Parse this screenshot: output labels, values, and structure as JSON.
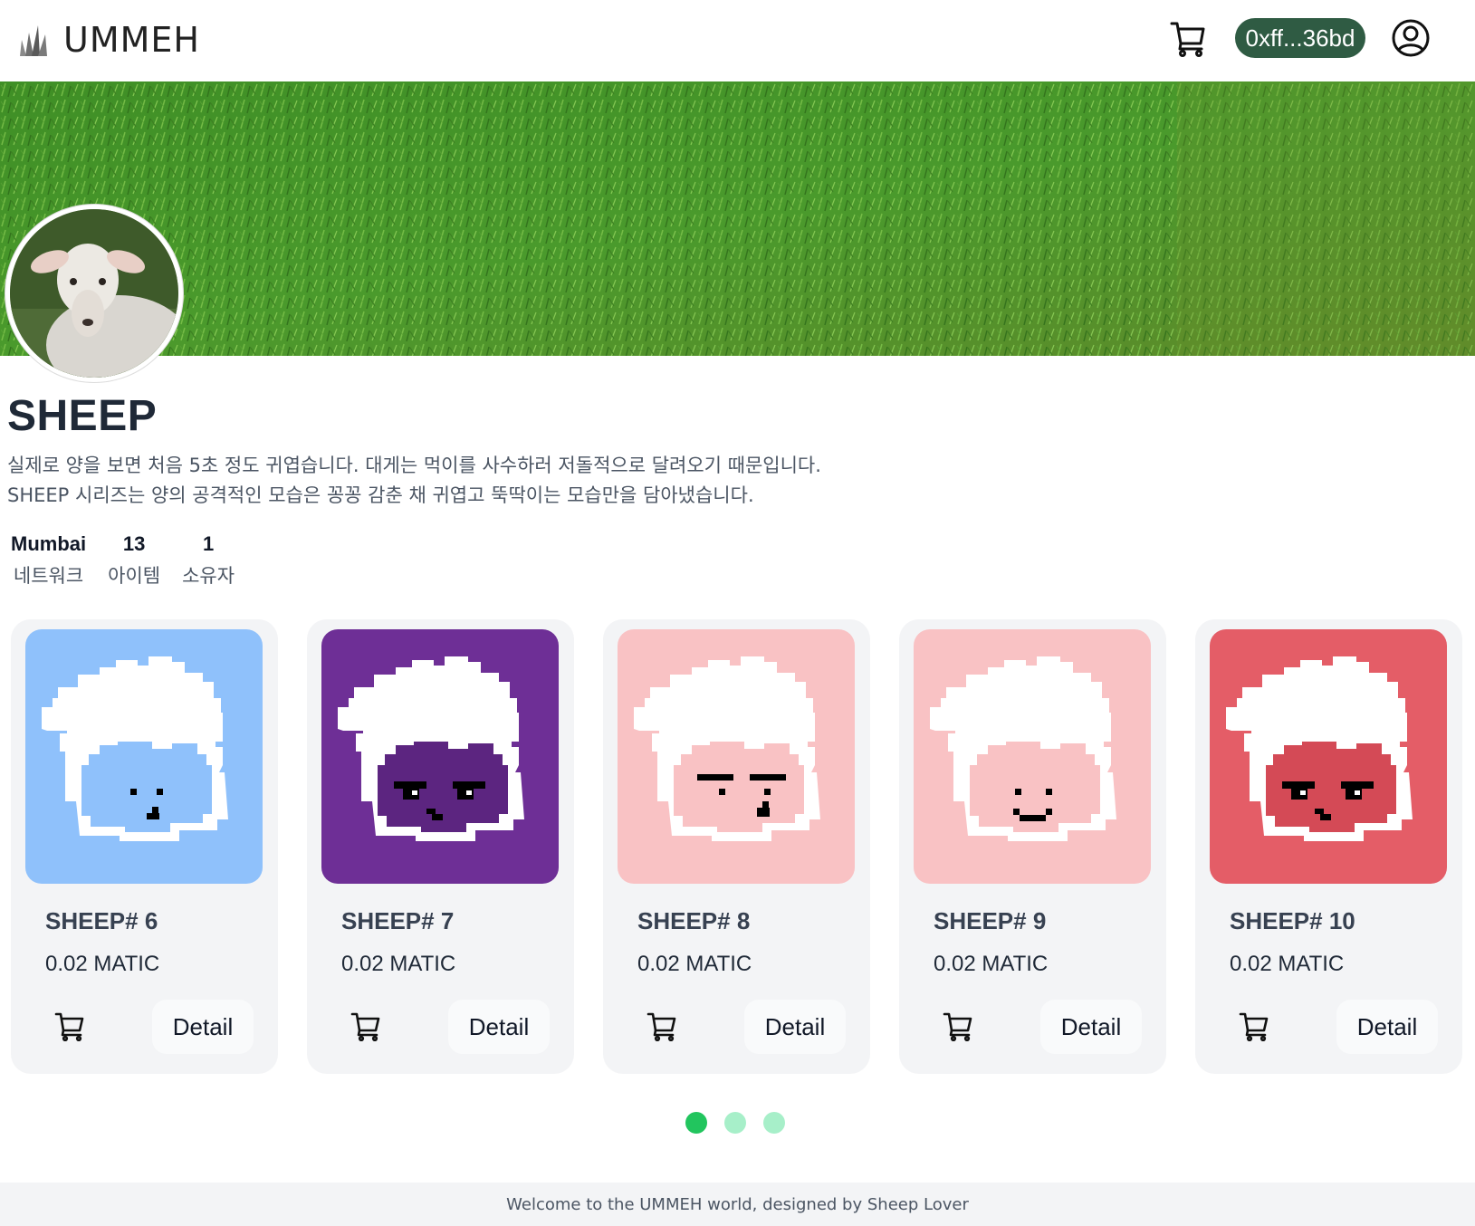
{
  "header": {
    "logo_text": "UMMEH",
    "wallet_label": "0xff...36bd"
  },
  "collection": {
    "title": "SHEEP",
    "description_line1": "실제로 양을 보면 처음 5초 정도 귀엽습니다. 대게는 먹이를 사수하러 저돌적으로 달려오기 때문입니다.",
    "description_line2": "SHEEP 시리즈는 양의 공격적인 모습은 꽁꽁 감춘 채 귀엽고 뚝딱이는 모습만을 담아냈습니다.",
    "stats": [
      {
        "value": "Mumbai",
        "label": "네트워크"
      },
      {
        "value": "13",
        "label": "아이템"
      },
      {
        "value": "1",
        "label": "소유자"
      }
    ]
  },
  "cards": [
    {
      "name": "SHEEP# 6",
      "price": "0.02 MATIC",
      "detail_label": "Detail",
      "bg": "#8fc1fb",
      "face": "neutral"
    },
    {
      "name": "SHEEP# 7",
      "price": "0.02 MATIC",
      "detail_label": "Detail",
      "bg": "#6e2f96",
      "face": "angry"
    },
    {
      "name": "SHEEP# 8",
      "price": "0.02 MATIC",
      "detail_label": "Detail",
      "bg": "#f9c2c4",
      "face": "flat"
    },
    {
      "name": "SHEEP# 9",
      "price": "0.02 MATIC",
      "detail_label": "Detail",
      "bg": "#f9c2c4",
      "face": "smile"
    },
    {
      "name": "SHEEP# 10",
      "price": "0.02 MATIC",
      "detail_label": "Detail",
      "bg": "#e45d67",
      "face": "angry"
    }
  ],
  "pager": {
    "pages": 3,
    "active_index": 0,
    "active_color": "#22c55e",
    "inactive_color": "#a7efc9"
  },
  "footer": {
    "text": "Welcome to the UMMEH world, designed by Sheep Lover"
  },
  "colors": {
    "wallet_bg": "#2f5b43",
    "card_bg": "#f3f4f6"
  }
}
